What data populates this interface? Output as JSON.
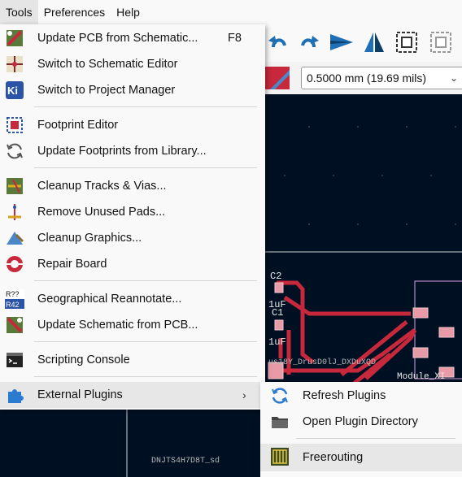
{
  "menubar": {
    "items": [
      "Tools",
      "Preferences",
      "Help"
    ]
  },
  "units_select": {
    "value": "0.5000 mm (19.69 mils)"
  },
  "tools_menu": {
    "update_pcb": {
      "label": "Update PCB from Schematic...",
      "shortcut": "F8"
    },
    "switch_schematic": {
      "label": "Switch to Schematic Editor"
    },
    "switch_project": {
      "label": "Switch to Project Manager"
    },
    "footprint_editor": {
      "label": "Footprint Editor"
    },
    "update_footprints": {
      "label": "Update Footprints from Library..."
    },
    "cleanup_tracks": {
      "label": "Cleanup Tracks & Vias..."
    },
    "remove_pads": {
      "label": "Remove Unused Pads..."
    },
    "cleanup_graphics": {
      "label": "Cleanup Graphics..."
    },
    "repair_board": {
      "label": "Repair Board"
    },
    "geo_reannotate": {
      "label": "Geographical Reannotate..."
    },
    "update_schematic": {
      "label": "Update Schematic from PCB..."
    },
    "scripting_console": {
      "label": "Scripting Console"
    },
    "external_plugins": {
      "label": "External Plugins",
      "arrow": "›"
    }
  },
  "plugins_submenu": {
    "refresh": {
      "label": "Refresh Plugins"
    },
    "open_dir": {
      "label": "Open Plugin Directory"
    },
    "freerouting": {
      "label": "Freerouting"
    }
  },
  "icons": {
    "ki": "Ki",
    "r42_top": "R??",
    "r42_bottom": "R42"
  },
  "pcb_text": {
    "c2": "C2",
    "c1": "C1",
    "uf1": "1uF",
    "uf2": "1uF",
    "module": "Module_XI",
    "mirrored1": "us18Y_DrusD0lJ_DXDuXQD",
    "mirrored2": "DNJTS4H7D8T_sd"
  },
  "colors": {
    "board_bg": "#001023",
    "track": "#c8283c",
    "menu_bg": "#f9f9f9",
    "hover": "#e7e7e7"
  }
}
